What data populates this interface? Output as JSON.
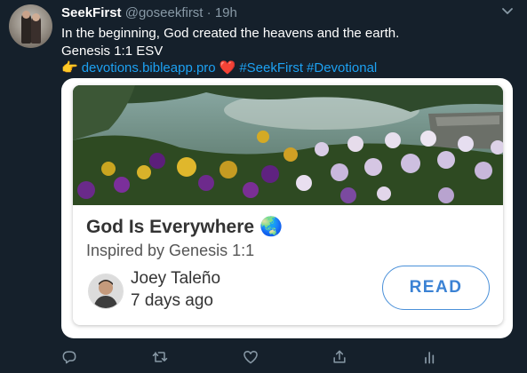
{
  "tweet": {
    "name": "SeekFirst",
    "handle": "@goseekfirst",
    "separator": "·",
    "time": "19h",
    "line1": "In the beginning, God created the heavens and the earth.",
    "line2": "Genesis 1:1 ESV",
    "pointing_emoji": "👉",
    "link": "devotions.bibleapp.pro",
    "heart_emoji": "❤️",
    "hashtag1": "#SeekFirst",
    "hashtag2": "#Devotional"
  },
  "card": {
    "title": "God Is Everywhere",
    "title_emoji": "🌏",
    "subtitle": "Inspired by Genesis 1:1",
    "author_name": "Joey Taleño",
    "author_time": "7 days ago",
    "button_label": "READ"
  },
  "icons": {
    "caret": "chevron-down-icon",
    "reply": "reply-icon",
    "retweet": "retweet-icon",
    "like": "like-icon",
    "share": "share-icon",
    "analytics": "analytics-icon"
  },
  "colors": {
    "background": "#15202b",
    "link": "#1da1f2",
    "secondary_text": "#8899a6",
    "button_border": "#4a90d9"
  }
}
